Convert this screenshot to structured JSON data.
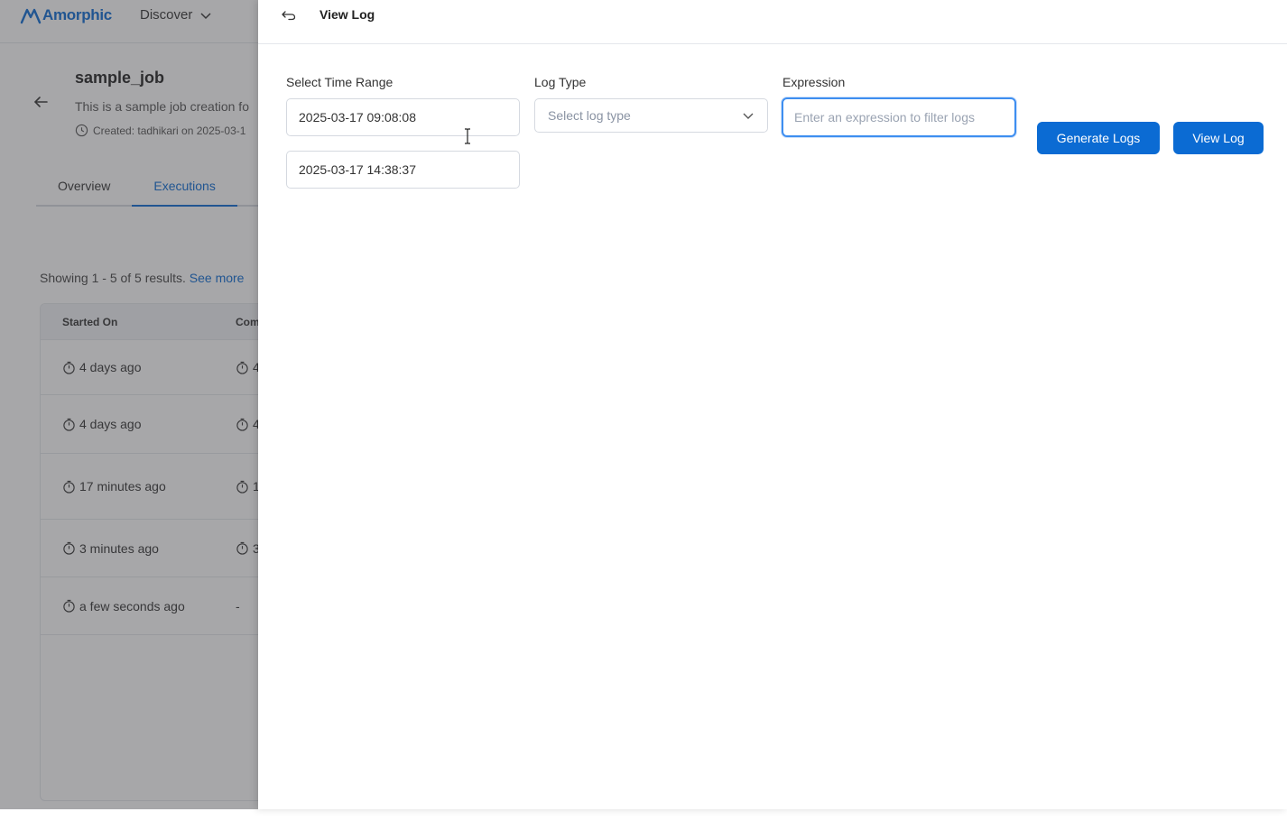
{
  "app": {
    "logo_text": "Amorphic",
    "nav_discover": "Discover"
  },
  "job": {
    "title": "sample_job",
    "description": "This is a sample job creation fo",
    "created": "Created: tadhikari on 2025-03-1"
  },
  "tabs": [
    "Overview",
    "Executions"
  ],
  "results": {
    "showing_text": "Showing 1 - 5 of 5 results.",
    "see_more": "See more"
  },
  "table": {
    "headers": [
      "Started On",
      "Com"
    ],
    "rows": [
      {
        "started": "4 days ago",
        "completed": "4"
      },
      {
        "started": "4 days ago",
        "completed": "4"
      },
      {
        "started": "17 minutes ago",
        "completed": "1"
      },
      {
        "started": "3 minutes ago",
        "completed": "3"
      },
      {
        "started": "a few seconds ago",
        "completed": "-"
      }
    ]
  },
  "drawer": {
    "title": "View Log",
    "time_range_label": "Select Time Range",
    "start_time": "2025-03-17 09:08:08",
    "end_time": "2025-03-17 14:38:37",
    "log_type_label": "Log Type",
    "log_type_placeholder": "Select log type",
    "expression_label": "Expression",
    "expression_placeholder": "Enter an expression to filter logs",
    "expression_value": "",
    "generate_button": "Generate Logs",
    "view_button": "View Log"
  },
  "colors": {
    "accent": "#0b6bd3",
    "focus_border": "#3e8ef0",
    "overlay": "rgba(60,60,64,0.45)"
  }
}
